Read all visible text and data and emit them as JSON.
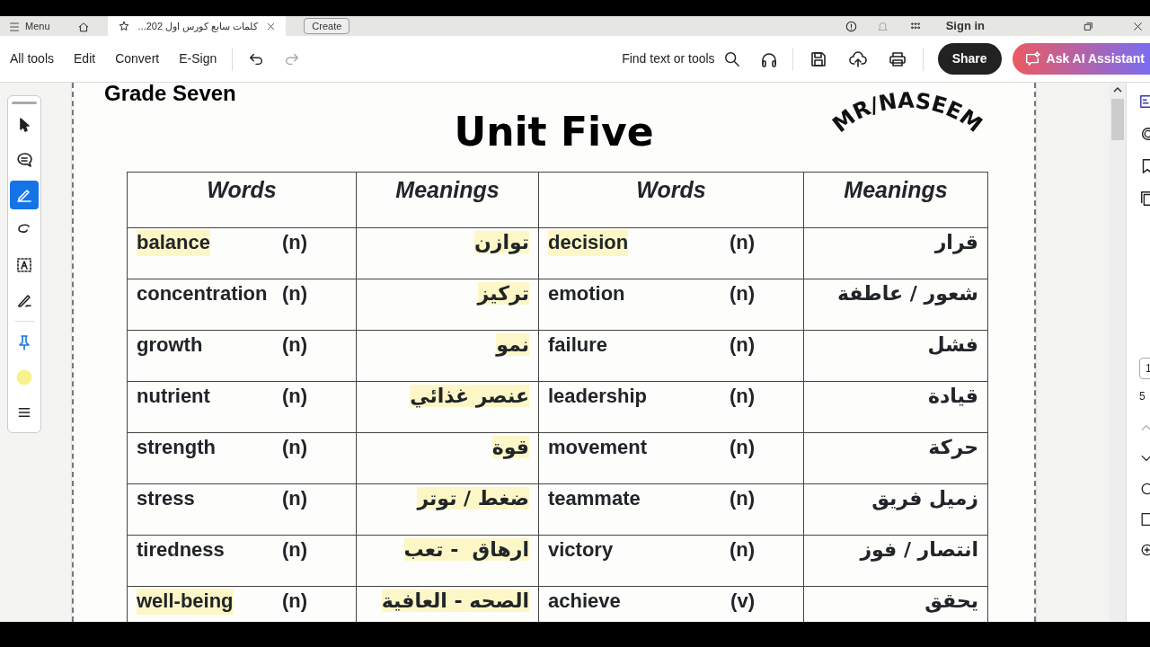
{
  "tab_strip": {
    "menu": "Menu",
    "tab": {
      "title": "كلمات سابع كورس اول 202...",
      "selected": true
    },
    "create": "Create",
    "sign_in": "Sign in"
  },
  "toolbar": {
    "menus": [
      "All tools",
      "Edit",
      "Convert",
      "E-Sign"
    ],
    "history": [
      {
        "kind": "undo",
        "disabled": false
      },
      {
        "kind": "redo",
        "disabled": true
      }
    ],
    "search": "Find text or tools",
    "share": "Share",
    "ai": "Ask AI Assistant"
  },
  "tools": [
    {
      "kind": "select",
      "selected": false
    },
    {
      "kind": "comment",
      "selected": false
    },
    {
      "kind": "highlight",
      "selected": true
    },
    {
      "kind": "draw",
      "selected": false
    },
    {
      "kind": "text",
      "selected": false
    },
    {
      "kind": "sign",
      "selected": false
    },
    {
      "kind": "pin",
      "selected": false
    },
    {
      "kind": "color",
      "selected": false,
      "color": "#f7f28c"
    },
    {
      "kind": "menu",
      "selected": false
    }
  ],
  "document": {
    "heading": "Grade Seven",
    "title": "Unit Five",
    "stamp": "MR/NASEEM",
    "columns": [
      "Words",
      "Meanings",
      "Words",
      "Meanings"
    ],
    "rows": [
      [
        {
          "word": "balance",
          "pos": "(n)",
          "meaning": "توازن",
          "word_highlighted": true,
          "meaning_highlighted": true
        },
        {
          "word": "decision",
          "pos": "(n)",
          "meaning": "قرار",
          "word_highlighted": true,
          "meaning_highlighted": false
        }
      ],
      [
        {
          "word": "concentration",
          "pos": "(n)",
          "meaning": "تركيز",
          "word_highlighted": false,
          "meaning_highlighted": true
        },
        {
          "word": "emotion",
          "pos": "(n)",
          "meaning": "شعور / عاطفة",
          "word_highlighted": false,
          "meaning_highlighted": false
        }
      ],
      [
        {
          "word": "growth",
          "pos": "(n)",
          "meaning": "نمو",
          "word_highlighted": false,
          "meaning_highlighted": true
        },
        {
          "word": "failure",
          "pos": "(n)",
          "meaning": "فشل",
          "word_highlighted": false,
          "meaning_highlighted": false
        }
      ],
      [
        {
          "word": "nutrient",
          "pos": "(n)",
          "meaning": "عنصر غذائي",
          "word_highlighted": false,
          "meaning_highlighted": true
        },
        {
          "word": "leadership",
          "pos": "(n)",
          "meaning": "قيادة",
          "word_highlighted": false,
          "meaning_highlighted": false
        }
      ],
      [
        {
          "word": "strength",
          "pos": "(n)",
          "meaning": "قوة",
          "word_highlighted": false,
          "meaning_highlighted": true
        },
        {
          "word": "movement",
          "pos": "(n)",
          "meaning": "حركة",
          "word_highlighted": false,
          "meaning_highlighted": false
        }
      ],
      [
        {
          "word": "stress",
          "pos": "(n)",
          "meaning": "ضغط / توتر",
          "word_highlighted": false,
          "meaning_highlighted": true
        },
        {
          "word": "teammate",
          "pos": "(n)",
          "meaning": "زميل فريق",
          "word_highlighted": false,
          "meaning_highlighted": false
        }
      ],
      [
        {
          "word": "tiredness",
          "pos": "(n)",
          "meaning": "ارهاق  - تعب",
          "word_highlighted": false,
          "meaning_highlighted": true
        },
        {
          "word": "victory",
          "pos": "(n)",
          "meaning": "انتصار / فوز",
          "word_highlighted": false,
          "meaning_highlighted": false
        }
      ],
      [
        {
          "word": "well-being",
          "pos": "(n)",
          "meaning": "الصحه - العافية",
          "word_highlighted": true,
          "meaning_highlighted": true
        },
        {
          "word": "achieve",
          "pos": "(v)",
          "meaning": "يحقق",
          "word_highlighted": false,
          "meaning_highlighted": false
        }
      ]
    ]
  },
  "pager": {
    "page": "1",
    "total": "5"
  }
}
